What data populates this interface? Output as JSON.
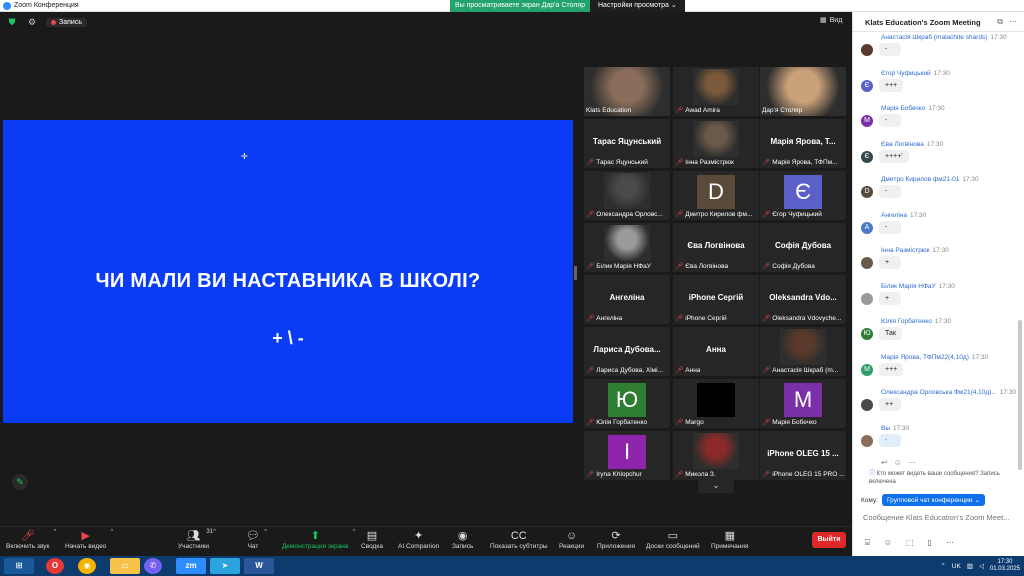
{
  "titlebar": {
    "title": "Zoom Конференция",
    "min": "—",
    "max": "▢",
    "close": "✕"
  },
  "share_banner": "Вы просматриваете экран Дар'а Столяр",
  "view_settings": "Настройки просмотра",
  "top_left": {
    "record_label": "Запись"
  },
  "view_button": "Вид",
  "shared_screen": {
    "question": "ЧИ МАЛИ ВИ НАСТАВНИКА В ШКОЛІ?",
    "options": "+ \\ -",
    "cursor": "✛"
  },
  "gallery": {
    "tiles": [
      {
        "label": "Klats Education",
        "big": "",
        "avatar": "",
        "avatar_color": "#8a6d5a",
        "muted": false,
        "photo": true
      },
      {
        "label": "Awad Amira",
        "big": "",
        "avatar": "",
        "avatar_color": "#7a5a3a",
        "muted": true,
        "photo": true
      },
      {
        "label": "Дар'я Столяр",
        "big": "",
        "avatar": "",
        "avatar_color": "#caa27a",
        "muted": false,
        "photo": true,
        "active": true
      },
      {
        "label": "Тарас Яцунський",
        "big": "Тарас Яцунський",
        "avatar": "",
        "muted": true
      },
      {
        "label": "Інна Размістрюк",
        "big": "",
        "avatar": "",
        "avatar_color": "#6a5a4a",
        "muted": true,
        "photo": true
      },
      {
        "label": "Марія Ярова, ТФПм...",
        "big": "Марія Ярова, Т...",
        "avatar": "",
        "muted": true
      },
      {
        "label": "Олександра Орловс...",
        "big": "",
        "avatar": "",
        "avatar_color": "#4a4a4a",
        "muted": true,
        "photo": true
      },
      {
        "label": "Дмитро Кирилов фм...",
        "big": "",
        "avatar": "D",
        "avatar_color": "#5a4a3a",
        "muted": true
      },
      {
        "label": "Єгор Чуфицький",
        "big": "",
        "avatar": "Є",
        "avatar_color": "#5a60c8",
        "muted": true
      },
      {
        "label": "Білик Марія НФаУ",
        "big": "",
        "avatar": "",
        "avatar_color": "#9a9a9a",
        "muted": true,
        "photo": true
      },
      {
        "label": "Єва Логвінова",
        "big": "Єва Логвінова",
        "avatar": "",
        "muted": true
      },
      {
        "label": "Софія Дубова",
        "big": "Софія Дубова",
        "avatar": "",
        "muted": true
      },
      {
        "label": "Ангеліна",
        "big": "Ангеліна",
        "avatar": "",
        "muted": true
      },
      {
        "label": "iPhone Сергій",
        "big": "iPhone Сергій",
        "avatar": "",
        "muted": true
      },
      {
        "label": "Oleksandra Vdovyche...",
        "big": "Oleksandra Vdo...",
        "avatar": "",
        "muted": true
      },
      {
        "label": "Лариса Дубова, Хімі...",
        "big": "Лариса Дубова...",
        "avatar": "",
        "muted": true
      },
      {
        "label": "Анна",
        "big": "Анна",
        "avatar": "",
        "muted": true
      },
      {
        "label": "Анастасія Шкраб (m...",
        "big": "",
        "avatar": "",
        "avatar_color": "#5a3a2a",
        "muted": true,
        "photo": true
      },
      {
        "label": "Юлія Горбатенко",
        "big": "",
        "avatar": "Ю",
        "avatar_color": "#2e7d32",
        "muted": true
      },
      {
        "label": "Margo",
        "big": "",
        "avatar": "",
        "avatar_color": "#000000",
        "muted": true
      },
      {
        "label": "Марія Бобечко",
        "big": "",
        "avatar": "М",
        "avatar_color": "#7b2fa8",
        "muted": true
      },
      {
        "label": "Iryna Khlopchur",
        "big": "",
        "avatar": "I",
        "avatar_color": "#8e24aa",
        "muted": true
      },
      {
        "label": "Микола З.",
        "big": "",
        "avatar": "",
        "avatar_color": "#8a2a2a",
        "muted": true,
        "photo": true
      },
      {
        "label": "iPhone OLEG 15 PRO ...",
        "big": "iPhone OLEG 15 ...",
        "avatar": "",
        "muted": true
      }
    ],
    "more": "⌄"
  },
  "toolbar": {
    "items": [
      {
        "label": "Включить звук",
        "icon": "🎤︎"
      },
      {
        "label": "Начать видео",
        "icon": "▶︎"
      },
      {
        "label": "Участники",
        "icon": "👥︎",
        "count": "31"
      },
      {
        "label": "Чат",
        "icon": "💬︎"
      },
      {
        "label": "Демонстрация экрана",
        "icon": "⬆"
      },
      {
        "label": "Сводка",
        "icon": "▤"
      },
      {
        "label": "AI Companion",
        "icon": "✦"
      },
      {
        "label": "Запись",
        "icon": "◉"
      },
      {
        "label": "Показать субтитры",
        "icon": "CC"
      },
      {
        "label": "Реакции",
        "icon": "☺"
      },
      {
        "label": "Приложения",
        "icon": "⟳"
      },
      {
        "label": "Доски сообщений",
        "icon": "▭"
      },
      {
        "label": "Примечания",
        "icon": "▦"
      }
    ],
    "leave": "Выйти"
  },
  "chat": {
    "title": "Klats Education's Zoom Meeting",
    "messages": [
      {
        "name": "Анастасія Шкраб (malachite shards)",
        "time": "17:30",
        "text": "-",
        "avatar": "",
        "avatar_color": "#5a3a2a"
      },
      {
        "name": "Єгор Чуфицький",
        "time": "17:30",
        "text": "+++",
        "avatar": "Є",
        "avatar_color": "#5a60c8"
      },
      {
        "name": "Марія Бобечко",
        "time": "17:30",
        "text": "-",
        "avatar": "М",
        "avatar_color": "#7b2fa8"
      },
      {
        "name": "Єва Логвінова",
        "time": "17:30",
        "text": "++++'",
        "avatar": "Є",
        "avatar_color": "#37474f"
      },
      {
        "name": "Дмитро Кирилов фм21-01",
        "time": "17:30",
        "text": "-",
        "avatar": "D",
        "avatar_color": "#5a4a3a"
      },
      {
        "name": "Ангеліна",
        "time": "17:30",
        "text": "-",
        "avatar": "А",
        "avatar_color": "#4a7ac8"
      },
      {
        "name": "Інна Размістрюк",
        "time": "17:30",
        "text": "+",
        "avatar": "",
        "avatar_color": "#6a5a4a"
      },
      {
        "name": "Білик Марія НФаУ",
        "time": "17:30",
        "text": "+",
        "avatar": "",
        "avatar_color": "#9a9a9a"
      },
      {
        "name": "Юлія Горбатенко",
        "time": "17:30",
        "text": "Так",
        "avatar": "Ю",
        "avatar_color": "#2e7d32"
      },
      {
        "name": "Марія Ярова, ТФПм22(4,10д)",
        "time": "17:30",
        "text": "+++",
        "avatar": "М",
        "avatar_color": "#2e9e6a"
      },
      {
        "name": "Олександра Орловська Фм21(4,10д)...",
        "time": "17:30",
        "text": "++",
        "avatar": "",
        "avatar_color": "#4a4a4a"
      },
      {
        "name": "Вы",
        "time": "17:30",
        "text": "-",
        "avatar": "",
        "avatar_color": "#8a6d5a",
        "mine": true
      }
    ],
    "who_sees": "Кто может видеть ваши сообщения? Запись включена",
    "recipient_label": "Кому:",
    "recipient_value": "Групповой чат конференции ⌄",
    "input_placeholder": "Сообщение Klats Education's Zoom Meet..."
  },
  "taskbar": {
    "lang": "UK",
    "time": "17:30",
    "date": "01.03.2025"
  }
}
